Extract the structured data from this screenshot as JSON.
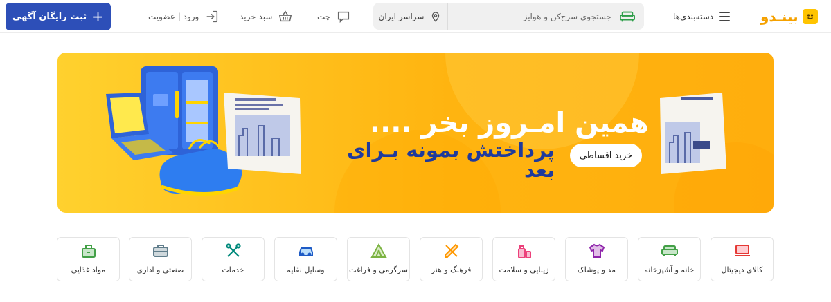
{
  "header": {
    "logo_text": "بینـدو",
    "post_ad_label": "ثبت رایگان آگهی",
    "login_label": "ورود | عضویت",
    "cart_label": "سبد خرید",
    "chat_label": "چت",
    "location_label": "سراسر ایران",
    "search_placeholder": "جستجوی سرخ‌کن و هوایز",
    "categories_label": "دسته‌بندی‌ها"
  },
  "banner": {
    "headline": "همین امـروز بخر ....",
    "subline": "پرداختش بمونه بـرای بعد",
    "badge": "خرید اقساطی"
  },
  "categories": [
    {
      "label": "کالای دیجیتال",
      "icon": "laptop-icon",
      "color": "#e53935"
    },
    {
      "label": "خانه و آشپزخانه",
      "icon": "sofa-icon",
      "color": "#43a047"
    },
    {
      "label": "مد و پوشاک",
      "icon": "shirt-icon",
      "color": "#8e24aa"
    },
    {
      "label": "زیبایی و سلامت",
      "icon": "cosmetics-icon",
      "color": "#ec407a"
    },
    {
      "label": "فرهنگ و هنر",
      "icon": "pencil-ruler-icon",
      "color": "#ff9800"
    },
    {
      "label": "سرگرمی و فراغت",
      "icon": "tent-icon",
      "color": "#7cb342"
    },
    {
      "label": "وسایل نقلیه",
      "icon": "car-icon",
      "color": "#1e5bc6"
    },
    {
      "label": "خدمات",
      "icon": "tools-icon",
      "color": "#00897b"
    },
    {
      "label": "صنعتی و اداری",
      "icon": "briefcase-icon",
      "color": "#607d8b"
    },
    {
      "label": "مواد غذایی",
      "icon": "grocery-icon",
      "color": "#43a047"
    }
  ],
  "colors": {
    "brand_yellow": "#ffc400",
    "primary_blue": "#2d4fb8",
    "banner_orange": "#ffb410"
  }
}
